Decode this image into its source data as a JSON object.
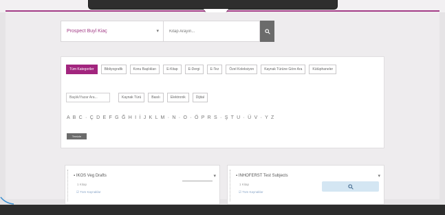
{
  "search": {
    "select_value": "Prospect Buyl Kiaç",
    "input_placeholder": "Kitap Arayın..."
  },
  "tabs": [
    {
      "label": "Tüm Kategoriler",
      "active": true
    },
    {
      "label": "Bibliyografik",
      "active": false
    },
    {
      "label": "Konu Başlıkları",
      "active": false
    },
    {
      "label": "E-Kitap",
      "active": false
    },
    {
      "label": "E-Dergi",
      "active": false
    },
    {
      "label": "E-Tez",
      "active": false
    },
    {
      "label": "Özel Koleksiyon",
      "active": false
    },
    {
      "label": "Kaynak Türüne Göre Ara",
      "active": false
    },
    {
      "label": "Kütüphaneler",
      "active": false
    }
  ],
  "filter": {
    "input_placeholder": "Başlık/Yazar Ara...",
    "buttons": [
      "Kaynak Türü",
      "Basılı",
      "Elektronik",
      "Dijital"
    ]
  },
  "alphabet": "A B C · Ç D E F G Ğ H I İ J K L M · N · O · Ö P R S · Ş T U · Ü V · Y Z",
  "clear_label": "Temizle",
  "cards": [
    {
      "title": "IKOS Veg Drafts",
      "meta": "1 Kitap",
      "more": "Tüm Kaynaklar"
    },
    {
      "title": "INHOFERST Test Subjects",
      "meta": "1 Kitap",
      "more": "Tüm Kaynaklar"
    }
  ],
  "colors": {
    "accent": "#a2257e",
    "header_line": "#a23b86",
    "search_button": "#6b6b6b"
  }
}
